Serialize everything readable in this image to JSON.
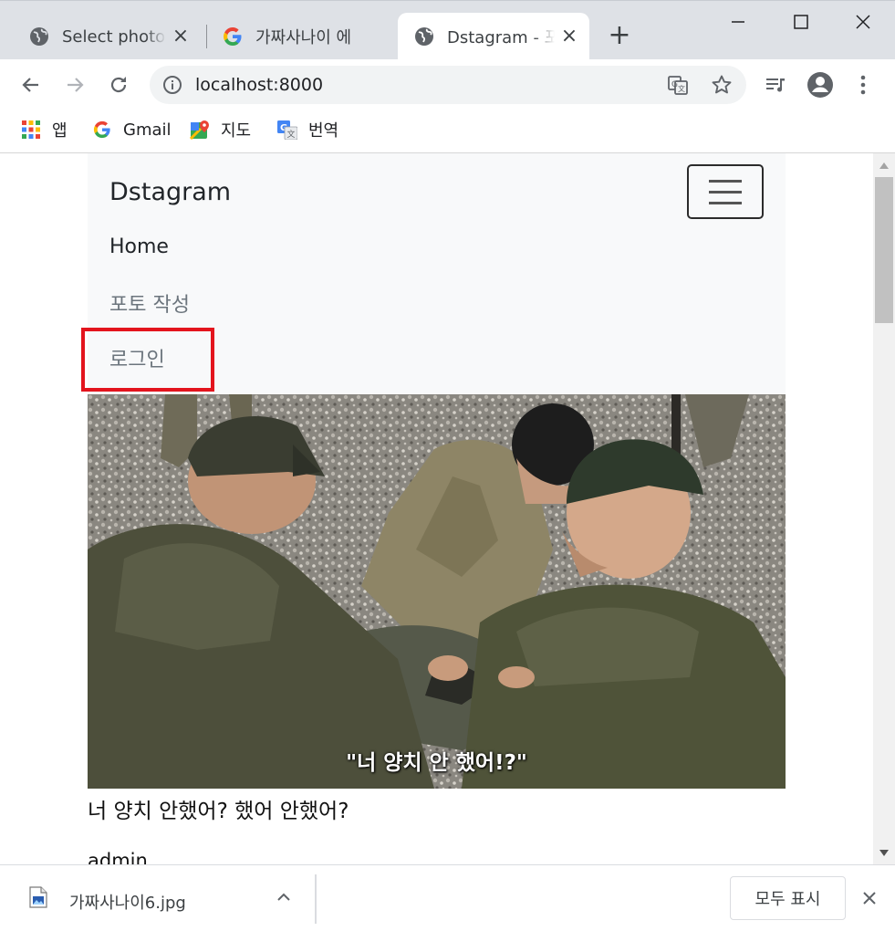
{
  "browser": {
    "tabs": [
      {
        "title": "Select photo t",
        "close": "×",
        "active": false
      },
      {
        "title": "가짜사나이 에",
        "close": "×",
        "active": false
      },
      {
        "title": "Dstagram - 포",
        "close": "×",
        "active": true
      }
    ],
    "new_tab": "+",
    "address": "localhost:8000",
    "bookmarks": [
      {
        "label": "앱",
        "icon": "apps-grid-icon"
      },
      {
        "label": "Gmail",
        "icon": "google-g-icon"
      },
      {
        "label": "지도",
        "icon": "maps-pin-icon"
      },
      {
        "label": "번역",
        "icon": "translate-icon"
      }
    ]
  },
  "page": {
    "brand": "Dstagram",
    "nav": {
      "home": "Home",
      "write": "포토 작성",
      "login": "로그인"
    },
    "post": {
      "image_caption": "\"너 양치 안 했어!?\"",
      "text": "너 양치 안했어? 했어 안했어?",
      "author": "admin"
    }
  },
  "downloads": {
    "file_name": "가짜사나이6.jpg",
    "show_all": "모두 표시"
  },
  "colors": {
    "highlight_box": "#e3141d",
    "navbar_bg": "#f8f9fa",
    "tabstrip_bg": "#dee1e6"
  }
}
